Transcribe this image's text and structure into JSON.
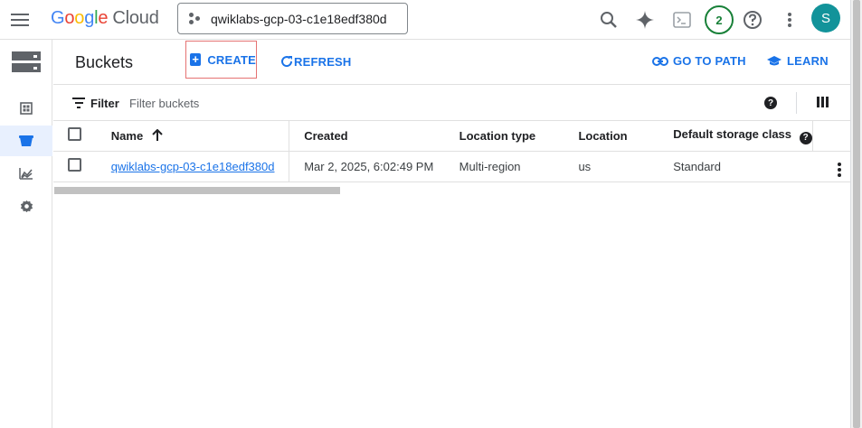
{
  "header": {
    "logo": {
      "g1": "G",
      "g2": "o",
      "g3": "o",
      "g4": "g",
      "g5": "l",
      "g6": "e",
      "cloud": "Cloud"
    },
    "project_name": "qwiklabs-gcp-03-c1e18edf380d",
    "notification_count": "2",
    "avatar_initial": "S",
    "icons": [
      "menu-icon",
      "project-picker-icon",
      "search-icon",
      "gemini-sparkle-icon",
      "cloud-shell-icon",
      "help-icon",
      "more-vert-icon"
    ]
  },
  "leftnav": {
    "items": [
      {
        "icon": "storage-product-icon",
        "active": false
      },
      {
        "icon": "overview-icon",
        "active": false
      },
      {
        "icon": "buckets-icon",
        "active": true
      },
      {
        "icon": "monitoring-icon",
        "active": false
      },
      {
        "icon": "settings-icon",
        "active": false
      }
    ]
  },
  "actionbar": {
    "title": "Buckets",
    "create_label": "CREATE",
    "refresh_label": "REFRESH",
    "goto_label": "GO TO PATH",
    "learn_label": "LEARN"
  },
  "filter": {
    "label": "Filter",
    "placeholder": "Filter buckets",
    "value": ""
  },
  "table": {
    "headers": {
      "name": "Name",
      "created": "Created",
      "location_type": "Location type",
      "location": "Location",
      "storage_class": "Default storage class"
    },
    "sort": {
      "column": "name",
      "direction": "ascending"
    },
    "rows": [
      {
        "name": "qwiklabs-gcp-03-c1e18edf380d",
        "created": "Mar 2, 2025, 6:02:49 PM",
        "location_type": "Multi-region",
        "location": "us",
        "storage_class": "Standard"
      }
    ]
  },
  "colors": {
    "accent": "#1a73e8",
    "create_highlight": "#e57373",
    "notif_green": "#188038",
    "avatar": "#12939a"
  }
}
